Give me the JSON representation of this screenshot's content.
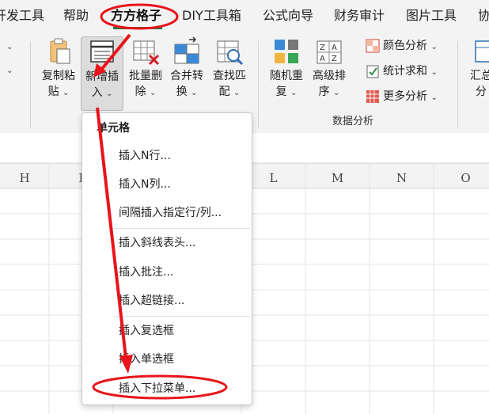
{
  "tabs": [
    "开发工具",
    "帮助",
    "方方格子",
    "DIY工具箱",
    "公式向导",
    "财务审计",
    "图片工具",
    "协"
  ],
  "active_tab": "方方格子",
  "ribbon": {
    "buttons": [
      {
        "line1": "复制粘",
        "line2": "贴",
        "icon": "paste-icon"
      },
      {
        "line1": "新增插",
        "line2": "入",
        "icon": "insert-rows-icon"
      },
      {
        "line1": "批量删",
        "line2": "除",
        "icon": "batch-delete-icon"
      },
      {
        "line1": "合并转",
        "line2": "换",
        "icon": "merge-convert-icon"
      },
      {
        "line1": "查找匹",
        "line2": "配",
        "icon": "find-match-icon"
      },
      {
        "line1": "随机重",
        "line2": "复",
        "icon": "random-repeat-icon"
      },
      {
        "line1": "高级排",
        "line2": "序",
        "icon": "advanced-sort-icon"
      },
      {
        "line1": "汇总",
        "line2": "分",
        "icon": "summary-icon"
      }
    ],
    "small_items": [
      "颜色分析",
      "统计求和",
      "更多分析"
    ],
    "group_label": "数据分析"
  },
  "columns": [
    "H",
    "I",
    "L",
    "M",
    "N",
    "O"
  ],
  "dropdown": {
    "header": "单元格",
    "items": [
      "插入N行...",
      "插入N列...",
      "间隔插入指定行/列...",
      "插入斜线表头...",
      "插入批注...",
      "插入超链接...",
      "插入复选框",
      "插入单选框",
      "插入下拉菜单..."
    ]
  },
  "colors": {
    "accent_green": "#1f7a3f",
    "annotation_red": "#e8141b"
  }
}
